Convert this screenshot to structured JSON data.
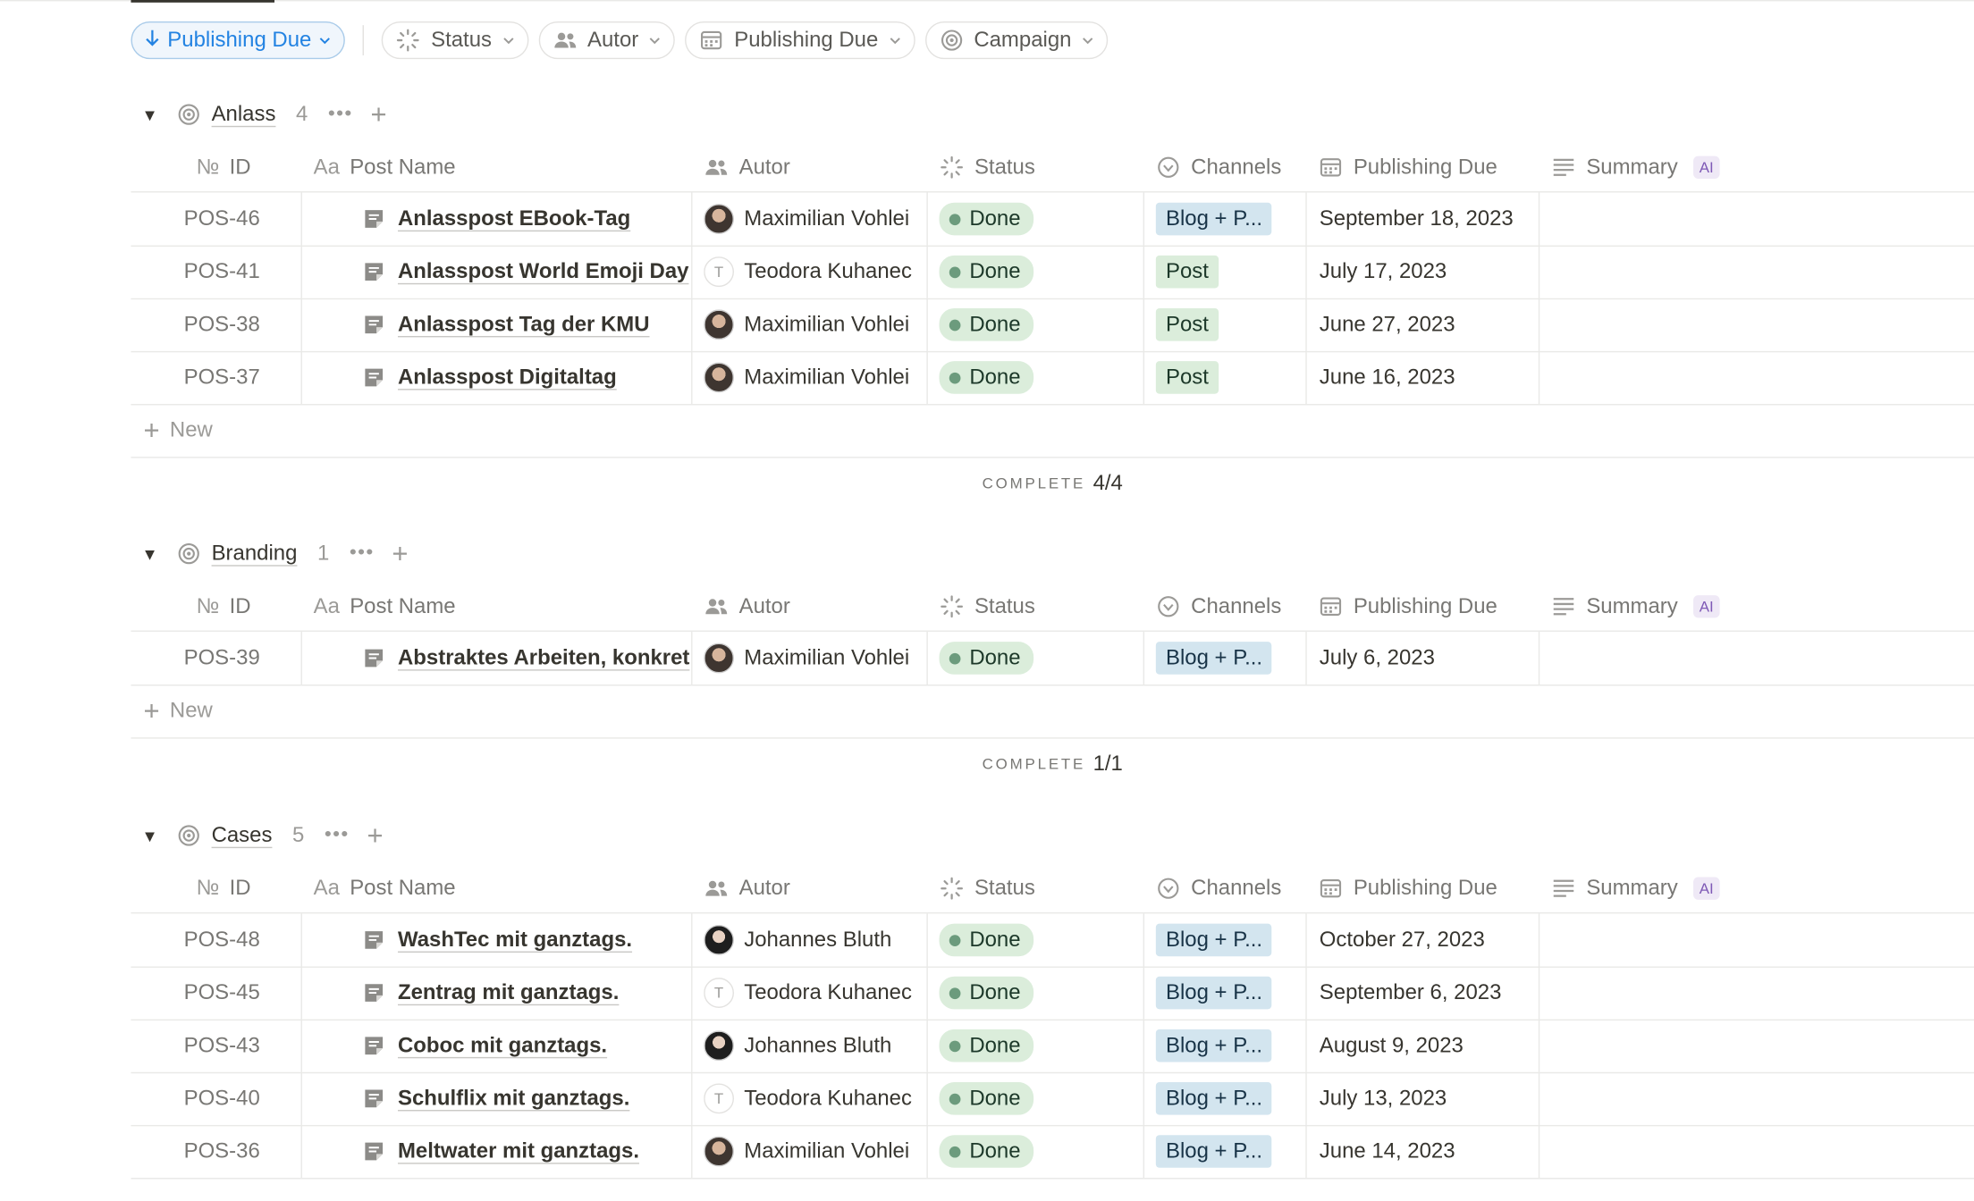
{
  "toolbar": {
    "sort_label": "Publishing Due",
    "filters": [
      {
        "label": "Status",
        "icon": "status-icon"
      },
      {
        "label": "Autor",
        "icon": "people-icon"
      },
      {
        "label": "Publishing Due",
        "icon": "calendar-icon"
      },
      {
        "label": "Campaign",
        "icon": "target-icon"
      }
    ]
  },
  "columns": {
    "id": "ID",
    "id_prefix": "№",
    "post_name": "Post Name",
    "post_name_prefix": "Aa",
    "autor": "Autor",
    "status": "Status",
    "channels": "Channels",
    "publishing_due": "Publishing Due",
    "summary": "Summary",
    "ai_badge": "AI"
  },
  "new_label": "New",
  "complete_label": "COMPLETE",
  "colors": {
    "accent": "#2383e2",
    "done_bg": "#dbeddb",
    "done_dot": "#6c9b7d",
    "channel_blue": "#d3e5ef",
    "ai_purple": "#7f5ab6"
  },
  "groups": [
    {
      "title": "Anlass",
      "count": "4",
      "complete": "4/4",
      "rows": [
        {
          "id": "POS-46",
          "name": "Anlasspost EBook-Tag",
          "autor": "Maximilian Vohlei",
          "avatar": "photo",
          "status": "Done",
          "channel": "Blog + P...",
          "channel_color": "blue",
          "due": "September 18, 2023"
        },
        {
          "id": "POS-41",
          "name": "Anlasspost World Emoji Day",
          "autor": "Teodora Kuhanec",
          "avatar": "T",
          "status": "Done",
          "channel": "Post",
          "channel_color": "green",
          "due": "July 17, 2023"
        },
        {
          "id": "POS-38",
          "name": "Anlasspost Tag der KMU",
          "autor": "Maximilian Vohlei",
          "avatar": "photo",
          "status": "Done",
          "channel": "Post",
          "channel_color": "green",
          "due": "June 27, 2023"
        },
        {
          "id": "POS-37",
          "name": "Anlasspost Digitaltag",
          "autor": "Maximilian Vohlei",
          "avatar": "photo",
          "status": "Done",
          "channel": "Post",
          "channel_color": "green",
          "due": "June 16, 2023"
        }
      ]
    },
    {
      "title": "Branding",
      "count": "1",
      "complete": "1/1",
      "rows": [
        {
          "id": "POS-39",
          "name": "Abstraktes Arbeiten, konkret",
          "autor": "Maximilian Vohlei",
          "avatar": "photo",
          "status": "Done",
          "channel": "Blog + P...",
          "channel_color": "blue",
          "due": "July 6, 2023"
        }
      ]
    },
    {
      "title": "Cases",
      "count": "5",
      "complete": "",
      "rows": [
        {
          "id": "POS-48",
          "name": "WashTec mit ganztags.",
          "autor": "Johannes Bluth",
          "avatar": "photo-jb",
          "status": "Done",
          "channel": "Blog + P...",
          "channel_color": "blue",
          "due": "October 27, 2023"
        },
        {
          "id": "POS-45",
          "name": "Zentrag mit ganztags.",
          "autor": "Teodora Kuhanec",
          "avatar": "T",
          "status": "Done",
          "channel": "Blog + P...",
          "channel_color": "blue",
          "due": "September 6, 2023"
        },
        {
          "id": "POS-43",
          "name": "Coboc mit ganztags.",
          "autor": "Johannes Bluth",
          "avatar": "photo-jb",
          "status": "Done",
          "channel": "Blog + P...",
          "channel_color": "blue",
          "due": "August 9, 2023"
        },
        {
          "id": "POS-40",
          "name": "Schulflix mit ganztags.",
          "autor": "Teodora Kuhanec",
          "avatar": "T",
          "status": "Done",
          "channel": "Blog + P...",
          "channel_color": "blue",
          "due": "July 13, 2023"
        },
        {
          "id": "POS-36",
          "name": "Meltwater mit ganztags.",
          "autor": "Maximilian Vohlei",
          "avatar": "photo",
          "status": "Done",
          "channel": "Blog + P...",
          "channel_color": "blue",
          "due": "June 14, 2023"
        }
      ]
    }
  ]
}
